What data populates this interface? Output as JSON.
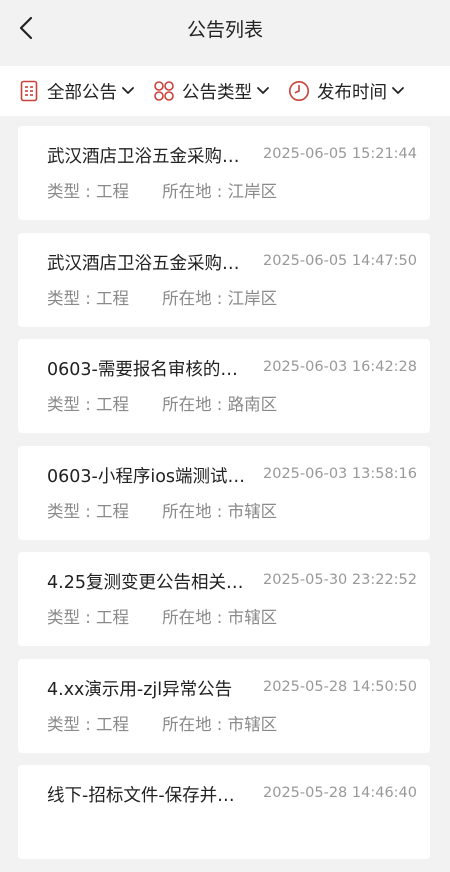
{
  "header": {
    "title": "公告列表"
  },
  "filters": [
    {
      "label": "全部公告",
      "icon": "document-list-icon"
    },
    {
      "label": "公告类型",
      "icon": "grid-category-icon"
    },
    {
      "label": "发布时间",
      "icon": "clock-icon"
    }
  ],
  "colors": {
    "accent": "#c9423a"
  },
  "notices": [
    {
      "title": "武汉酒店卫浴五金采购…",
      "time": "2025-06-05 15:21:44",
      "type": "类型 : 工程",
      "location": "所在地 : 江岸区"
    },
    {
      "title": "武汉酒店卫浴五金采购…",
      "time": "2025-06-05 14:47:50",
      "type": "类型 : 工程",
      "location": "所在地 : 江岸区"
    },
    {
      "title": "0603-需要报名审核的…",
      "time": "2025-06-03 16:42:28",
      "type": "类型 : 工程",
      "location": "所在地 : 路南区"
    },
    {
      "title": "0603-小程序ios端测试…",
      "time": "2025-06-03 13:58:16",
      "type": "类型 : 工程",
      "location": "所在地 : 市辖区"
    },
    {
      "title": "4.25复测变更公告相关…",
      "time": "2025-05-30 23:22:52",
      "type": "类型 : 工程",
      "location": "所在地 : 市辖区"
    },
    {
      "title": "4.xx演示用-zjl异常公告",
      "time": "2025-05-28 14:50:50",
      "type": "类型 : 工程",
      "location": "所在地 : 市辖区"
    },
    {
      "title": "线下-招标文件-保存并…",
      "time": "2025-05-28 14:46:40",
      "type": "",
      "location": ""
    }
  ]
}
